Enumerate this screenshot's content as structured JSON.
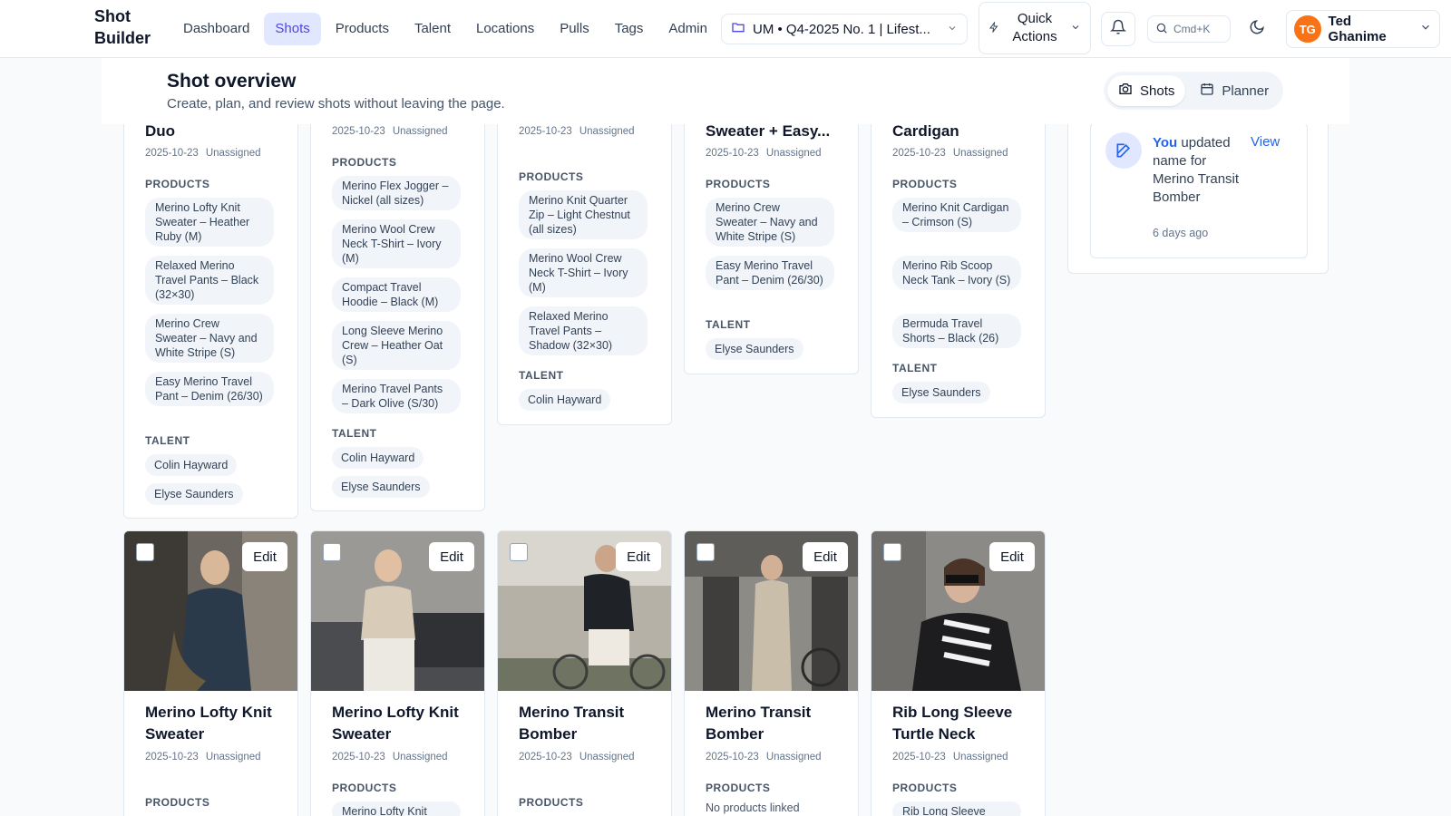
{
  "app": {
    "brand": "Shot Builder"
  },
  "nav": [
    "Dashboard",
    "Shots",
    "Products",
    "Talent",
    "Locations",
    "Pulls",
    "Tags",
    "Admin"
  ],
  "nav_active": "Shots",
  "project": {
    "label": "UM • Q4-2025 No. 1 | Lifest..."
  },
  "quick_actions": "Quick Actions",
  "search": {
    "shortcut": "Cmd+K"
  },
  "user": {
    "initials": "TG",
    "name": "Ted Ghanime"
  },
  "overview": {
    "title": "Shot overview",
    "subtitle": "Create, plan, and review shots without leaving the page.",
    "view_shots": "Shots",
    "view_planner": "Planner"
  },
  "labels": {
    "products": "PRODUCTS",
    "talent": "TALENT",
    "edit": "Edit",
    "no_products": "No products linked"
  },
  "top_cards": [
    {
      "title_tail": "Duo",
      "date": "2025-10-23",
      "status": "Unassigned",
      "products": [
        "Merino Lofty Knit Sweater – Heather Ruby (M)",
        "Relaxed Merino Travel Pants – Black (32×30)",
        "Merino Crew Sweater – Navy and White Stripe (S)",
        "Easy Merino Travel Pant – Denim (26/30)"
      ],
      "talent": [
        "Colin Hayward",
        "Elyse Saunders"
      ]
    },
    {
      "title_tail": "",
      "date": "2025-10-23",
      "status": "Unassigned",
      "products": [
        "Merino Flex Jogger – Nickel (all sizes)",
        "Merino Wool Crew Neck T-Shirt – Ivory (M)",
        "Compact Travel Hoodie – Black (M)",
        "Long Sleeve Merino Crew – Heather Oat (S)",
        "Merino Travel Pants – Dark Olive (S/30)"
      ],
      "talent": [
        "Colin Hayward",
        "Elyse Saunders"
      ]
    },
    {
      "title_tail": "",
      "date": "2025-10-23",
      "status": "Unassigned",
      "products": [
        "Merino Knit Quarter Zip – Light Chestnut (all sizes)",
        "Merino Wool Crew Neck T-Shirt – Ivory (M)",
        "Relaxed Merino Travel Pants – Shadow (32×30)"
      ],
      "talent": [
        "Colin Hayward"
      ]
    },
    {
      "title_tail": "Sweater + Easy...",
      "date": "2025-10-23",
      "status": "Unassigned",
      "products": [
        "Merino Crew Sweater – Navy and White Stripe (S)",
        "Easy Merino Travel Pant – Denim (26/30)"
      ],
      "talent": [
        "Elyse Saunders"
      ]
    },
    {
      "title_tail": "Cardigan",
      "date": "2025-10-23",
      "status": "Unassigned",
      "products": [
        "Merino Knit Cardigan – Crimson (S)",
        "Merino Rib Scoop Neck Tank – Ivory (S)",
        "Bermuda Travel Shorts – Black (26)"
      ],
      "talent": [
        "Elyse Saunders"
      ]
    }
  ],
  "bottom_cards": [
    {
      "title": "Merino Lofty Knit Sweater",
      "date": "2025-10-23",
      "status": "Unassigned",
      "first_product": ""
    },
    {
      "title": "Merino Lofty Knit Sweater",
      "date": "2025-10-23",
      "status": "Unassigned",
      "first_product": "Merino Lofty Knit"
    },
    {
      "title": "Merino Transit Bomber",
      "date": "2025-10-23",
      "status": "Unassigned",
      "first_product": ""
    },
    {
      "title": "Merino Transit Bomber",
      "date": "2025-10-23",
      "status": "Unassigned",
      "first_product": "No products linked"
    },
    {
      "title": "Rib Long Sleeve Turtle Neck",
      "date": "2025-10-23",
      "status": "Unassigned",
      "first_product": "Rib Long Sleeve"
    }
  ],
  "activity": {
    "who": "You",
    "text": "updated name for Merino Transit Bomber",
    "time": "6 days ago",
    "view": "View"
  },
  "icons": [
    "folder-icon",
    "chevron-down-icon",
    "bolt-icon",
    "bell-icon",
    "search-icon",
    "moon-icon",
    "camera-icon",
    "calendar-icon",
    "edit-icon"
  ],
  "colors": {
    "accent": "#4f46e5",
    "link": "#2563eb",
    "avatar": "#f97316"
  }
}
